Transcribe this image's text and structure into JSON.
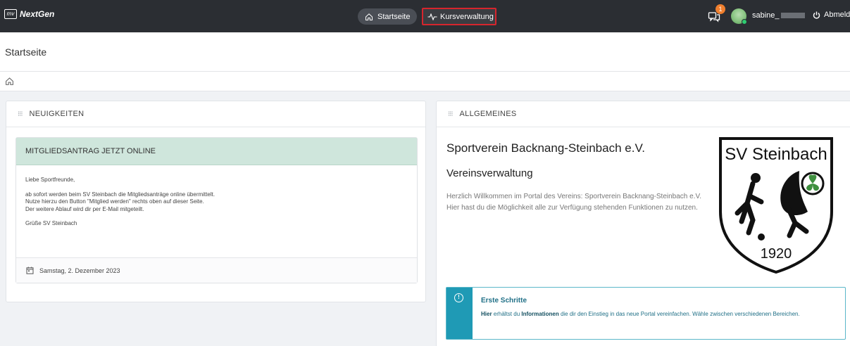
{
  "topbar": {
    "brand": "NextGen",
    "brand_logo": "mv",
    "nav": {
      "home_label": "Startseite",
      "courses_label": "Kursverwaltung"
    },
    "notifications_count": "1",
    "username": "sabine_",
    "logout_label": "Abmelden"
  },
  "page": {
    "title": "Startseite"
  },
  "news": {
    "header": "NEUIGKEITEN",
    "item_title": "MITGLIEDSANTRAG JETZT ONLINE",
    "greeting": "Liebe Sportfreunde,",
    "line1": "ab sofort werden beim SV Steinbach die Mitgliedsanträge online übermittelt.",
    "line2": "Nutze hierzu den Button \"Mitglied werden\" rechts oben auf dieser Seite.",
    "line3": "Der weitere Ablauf wird dir per E-Mail mitgeteilt.",
    "closing": "Grüße SV Steinbach",
    "date": "Samstag, 2. Dezember 2023"
  },
  "general": {
    "header": "ALLGEMEINES",
    "org_name": "Sportverein Backnang-Steinbach e.V.",
    "subtitle": "Vereinsverwaltung",
    "welcome": "Herzlich Willkommen im Portal des Vereins: Sportverein Backnang-Steinbach e.V.",
    "welcome2": "Hier hast du die Möglichkeit alle zur Verfügung stehenden Funktionen zu nutzen.",
    "crest_text": "SV Steinbach",
    "crest_year": "1920",
    "info": {
      "title": "Erste Schritte",
      "text_bold1": "Hier",
      "text_part1": " erhältst du ",
      "text_bold2": "Informationen",
      "text_part2": " die dir den Einstieg in das neue Portal vereinfachen. Wähle zwischen verschiedenen Bereichen."
    }
  },
  "colors": {
    "topbar": "#2b2e33",
    "highlight": "#d6252d",
    "news_title_bg": "#cfe6dc",
    "info_accent": "#1f9ab5",
    "badge": "#f07f2e"
  },
  "icons": [
    "home-icon",
    "activity-icon",
    "chat-icon",
    "power-icon",
    "calendar-icon",
    "info-icon",
    "drag-handle-icon"
  ]
}
